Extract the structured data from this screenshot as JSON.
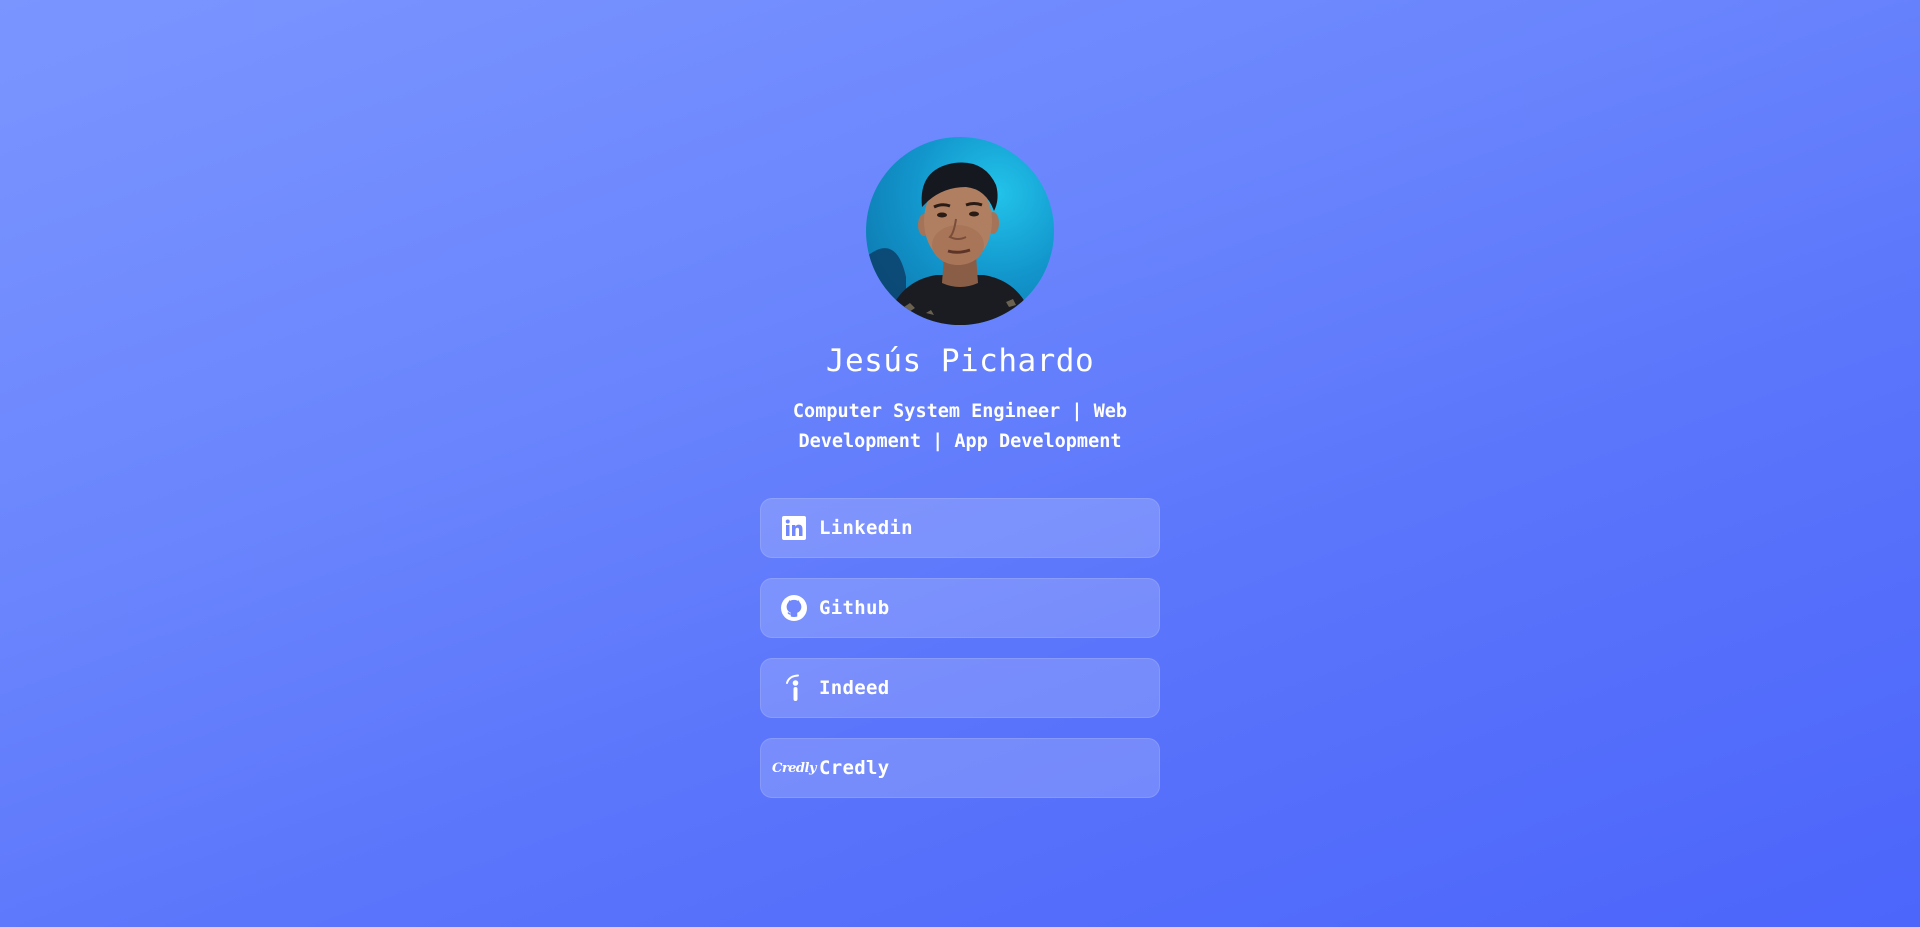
{
  "profile": {
    "name": "Jesús Pichardo",
    "bio": "Computer System Engineer | Web Development | App Development",
    "avatar_alt": "profile photo"
  },
  "links": [
    {
      "label": "Linkedin",
      "icon": "linkedin-icon"
    },
    {
      "label": "Github",
      "icon": "github-icon"
    },
    {
      "label": "Indeed",
      "icon": "indeed-icon"
    },
    {
      "label": "Credly",
      "icon": "credly-icon",
      "icon_text": "Credly"
    }
  ],
  "colors": {
    "background_start": "#7b95ff",
    "background_end": "#4c65fb",
    "card_background": "rgba(255,255,255,0.18)",
    "text": "#ffffff"
  }
}
